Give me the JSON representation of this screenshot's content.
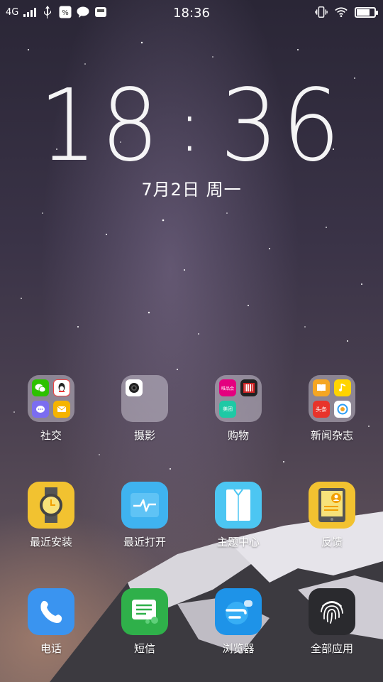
{
  "status_bar": {
    "network": "4G",
    "time": "18:36"
  },
  "clock": {
    "hour": "18",
    "minute": "36"
  },
  "date": "7月2日 周一",
  "folders": [
    {
      "label": "社交",
      "items": [
        "wechat-icon",
        "qq-icon",
        "chat-bubble-icon",
        "mail-icon"
      ]
    },
    {
      "label": "摄影",
      "items": [
        "camera-icon"
      ]
    },
    {
      "label": "购物",
      "items": [
        "vipshop-icon",
        "barcode-icon",
        "meituan-icon"
      ]
    },
    {
      "label": "新闻杂志",
      "items": [
        "book-icon",
        "music-note-icon",
        "toutiao-icon",
        "browser-icon"
      ]
    }
  ],
  "mini_labels": {
    "vipshop": "唯品会",
    "meituan": "美团",
    "toutiao": "头条"
  },
  "apps_row": [
    {
      "label": "最近安装",
      "icon": "watch-icon",
      "color": "#f2c230"
    },
    {
      "label": "最近打开",
      "icon": "pulse-icon",
      "color": "#3fb3f0"
    },
    {
      "label": "主题中心",
      "icon": "shirt-icon",
      "color": "#4cc6f2"
    },
    {
      "label": "反馈",
      "icon": "tablet-user-icon",
      "color": "#f2c230"
    }
  ],
  "dock": [
    {
      "label": "电话",
      "icon": "phone-icon",
      "color": "#3a94f0"
    },
    {
      "label": "短信",
      "icon": "message-icon",
      "color": "#2fb04a"
    },
    {
      "label": "浏览器",
      "icon": "browser-icon",
      "color": "#1e93e8"
    },
    {
      "label": "全部应用",
      "icon": "fingerprint-icon",
      "color": "#2a2a2e"
    }
  ]
}
